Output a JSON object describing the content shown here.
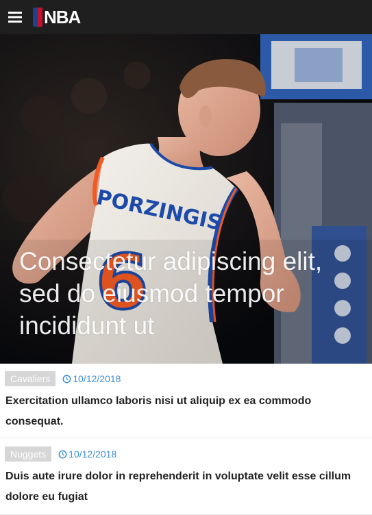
{
  "header": {
    "menu_icon": "hamburger-menu-icon",
    "logo_icon": "nba-logo-icon",
    "logo_text": "NBA",
    "background": "#1f1f1f"
  },
  "hero": {
    "title": "Consectetur adipiscing elit, sed do eiusmod tempor incididunt ut",
    "jersey_name": "PORZINGIS",
    "jersey_number": "6"
  },
  "articles": [
    {
      "category": "Cavaliers",
      "date": "10/12/2018",
      "title": "Exercitation ullamco laboris nisi ut aliquip ex ea commodo consequat."
    },
    {
      "category": "Nuggets",
      "date": "10/12/2018",
      "title": "Duis aute irure dolor in reprehenderit in voluptate velit esse cillum dolore eu fugiat"
    }
  ],
  "colors": {
    "accent": "#3b8fd6",
    "tag_background": "#d6d6d6",
    "logo_blue": "#1d428a",
    "logo_red": "#c8102e"
  }
}
